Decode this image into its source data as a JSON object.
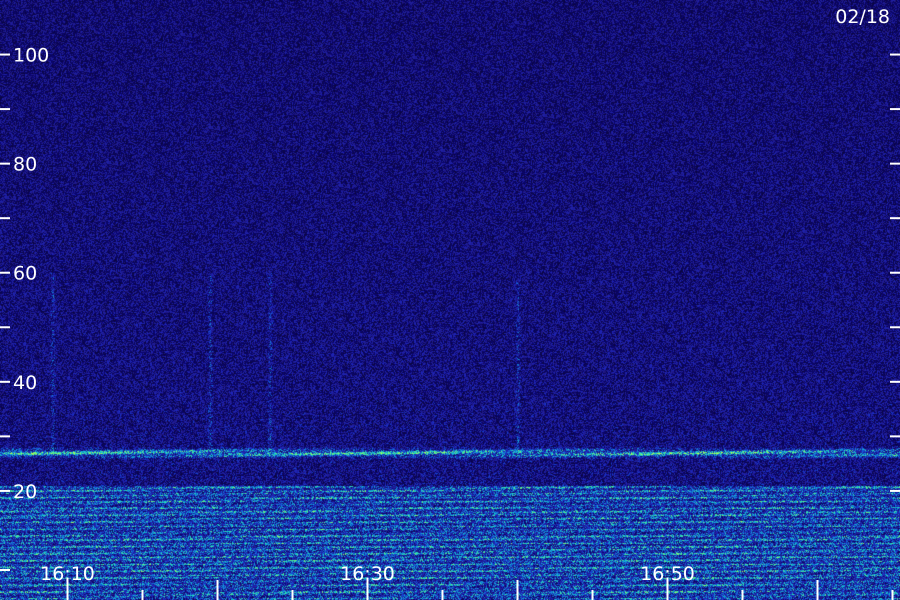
{
  "chart_data": {
    "type": "heatmap",
    "title": "",
    "date_label": "02/18",
    "xlabel": "",
    "ylabel": "",
    "x_tick_labels": [
      "16:10",
      "16:30",
      "16:50"
    ],
    "x_range_minutes": [
      5.5,
      65.5
    ],
    "y_major_ticks": [
      20,
      40,
      60,
      80,
      100
    ],
    "y_minor_ticks": [
      30,
      50,
      70,
      90
    ],
    "ylim": [
      0,
      110
    ],
    "colors": {
      "background": "#1a0a6e",
      "noise_dark": "#0c0540",
      "noise_mid": "#2a1aa8",
      "band_low": "#1050d0",
      "band_high": "#30e0b0",
      "band_peak": "#a0ff60",
      "axis": "#ffffff"
    },
    "features": {
      "bright_band_y": 27,
      "low_band_range": [
        2,
        21
      ],
      "vertical_streaks_minutes": [
        9.0,
        19.5,
        23.5,
        40.0
      ]
    }
  }
}
